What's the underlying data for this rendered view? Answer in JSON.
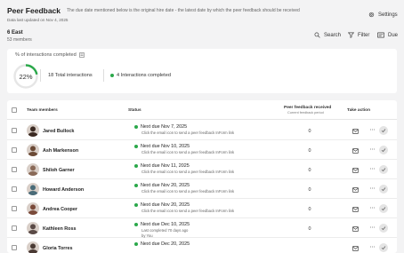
{
  "header": {
    "title": "Peer Feedback",
    "note": "The due date mentioned below is the original hire date - the latest date by which the peer feedback should be received",
    "updated": "Data last updated on Nov 4, 2025",
    "settings_label": "Settings"
  },
  "team": {
    "name": "6 East",
    "members": "53 members"
  },
  "toolbar": {
    "search_label": "Search",
    "filter_label": "Filter",
    "due_label": "Due"
  },
  "summary": {
    "title": "% of interactions completed",
    "percent_label": "22%",
    "percent_value": 0.22,
    "total": "18 Total interactions",
    "completed": "4 Interactions completed"
  },
  "table": {
    "col_members": "Team members",
    "col_status": "Status",
    "col_received": "Peer feedback received",
    "col_received_sub": "Current feedback period",
    "col_action": "Take action",
    "rows": [
      {
        "name": "Jared Bullock",
        "status": "Next due Nov 7, 2025",
        "sub1": "Click the email icon to send a peer feedback InForm link",
        "sub2": "",
        "count": "0",
        "avatar": "#3b2a22"
      },
      {
        "name": "Ash Markenson",
        "status": "Next due Nov 10, 2025",
        "sub1": "Click the email icon to send a peer feedback InForm link",
        "sub2": "",
        "count": "0",
        "avatar": "#6b4a36"
      },
      {
        "name": "Shiloh Garner",
        "status": "Next due Nov 11, 2025",
        "sub1": "Click the email icon to send a peer feedback InForm link",
        "sub2": "",
        "count": "0",
        "avatar": "#8a6a58"
      },
      {
        "name": "Howard Anderson",
        "status": "Next due Nov 20, 2025",
        "sub1": "Click the email icon to send a peer feedback InForm link",
        "sub2": "",
        "count": "0",
        "avatar": "#4a6b78"
      },
      {
        "name": "Andrea Cooper",
        "status": "Next due Nov 20, 2025",
        "sub1": "Click the email icon to send a peer feedback InForm link",
        "sub2": "",
        "count": "0",
        "avatar": "#7a4a3a"
      },
      {
        "name": "Kathleen Ross",
        "status": "Next due Dec 10, 2025",
        "sub1": "Last completed 70 days ago",
        "sub2": "by You",
        "count": "0",
        "avatar": "#5a4a46"
      },
      {
        "name": "Gloria Torres",
        "status": "Next due Dec 20, 2025",
        "sub1": "",
        "sub2": "",
        "count": "",
        "avatar": "#4a3a34"
      }
    ]
  },
  "colors": {
    "accent_green": "#2aa84a",
    "ring_track": "#e6e6e6"
  }
}
